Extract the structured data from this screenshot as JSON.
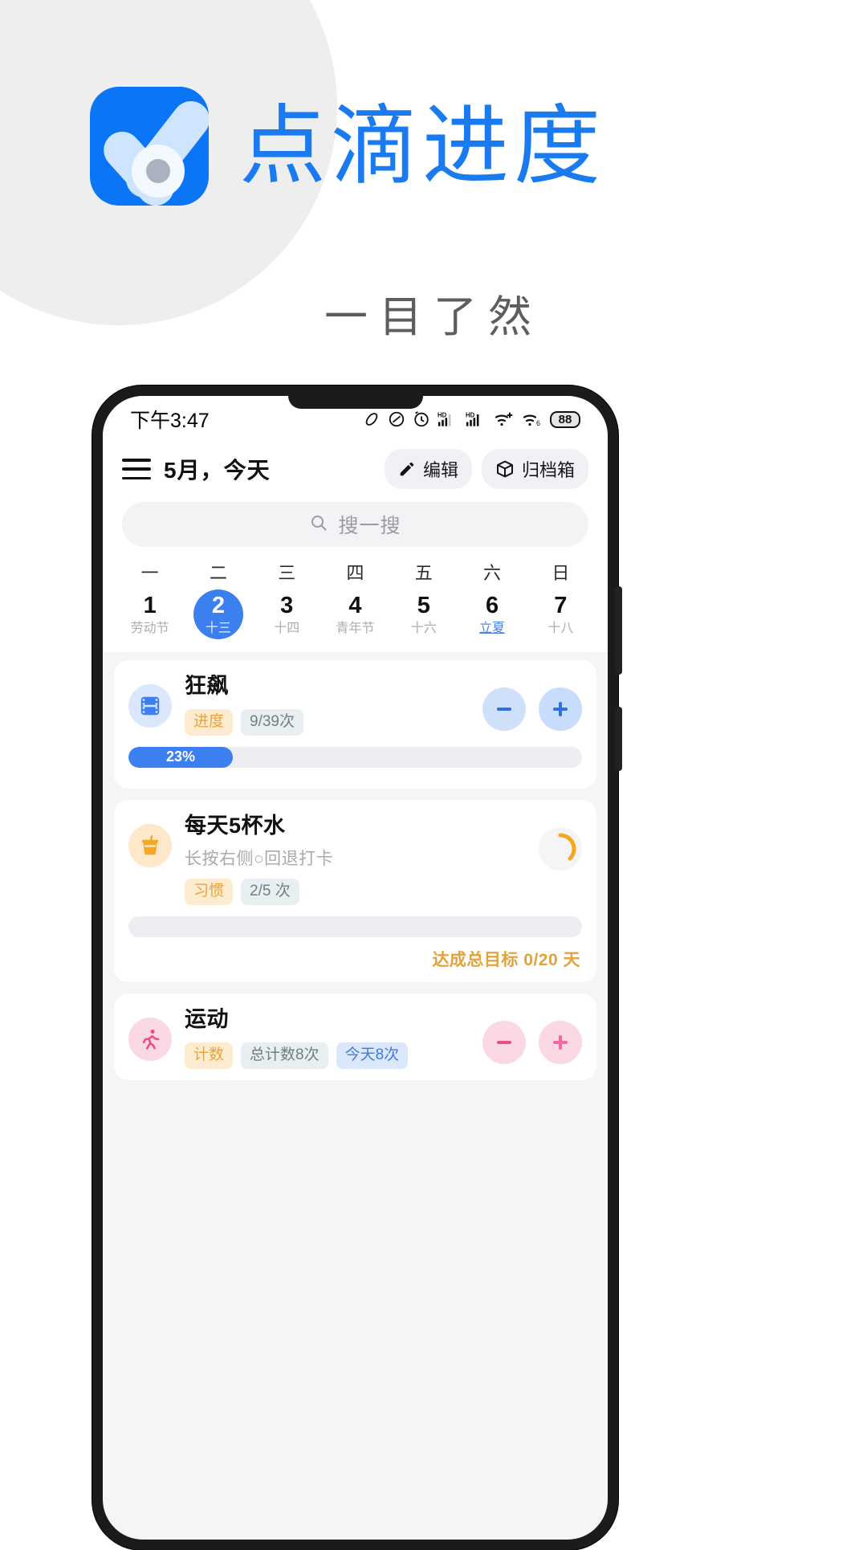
{
  "promo": {
    "app_name": "点滴进度",
    "tagline": "一目了然",
    "icon_name": "app-check-icon",
    "brand_color": "#1a7bf0"
  },
  "statusbar": {
    "time": "下午3:47",
    "battery": "88",
    "icons": [
      "link-icon",
      "mute-icon",
      "alarm-icon",
      "hd-signal-icon",
      "hd-signal-icon",
      "wifi-plus-icon",
      "wifi6-icon",
      "battery-icon"
    ]
  },
  "header": {
    "menu_icon": "hamburger-icon",
    "title": "5月，今天",
    "edit_label": "编辑",
    "edit_icon": "pencil-icon",
    "archive_label": "归档箱",
    "archive_icon": "box-icon"
  },
  "search": {
    "placeholder": "搜一搜",
    "icon": "search-icon"
  },
  "calendar": {
    "days": [
      {
        "dow": "一",
        "num": "1",
        "lunar": "劳动节",
        "selected": false,
        "festival": false
      },
      {
        "dow": "二",
        "num": "2",
        "lunar": "十三",
        "selected": true,
        "festival": false
      },
      {
        "dow": "三",
        "num": "3",
        "lunar": "十四",
        "selected": false,
        "festival": false
      },
      {
        "dow": "四",
        "num": "4",
        "lunar": "青年节",
        "selected": false,
        "festival": false
      },
      {
        "dow": "五",
        "num": "5",
        "lunar": "十六",
        "selected": false,
        "festival": false
      },
      {
        "dow": "六",
        "num": "6",
        "lunar": "立夏",
        "selected": false,
        "festival": true
      },
      {
        "dow": "日",
        "num": "7",
        "lunar": "十八",
        "selected": false,
        "festival": false
      }
    ],
    "selected_color": "#3b7ff0"
  },
  "tasks": [
    {
      "title": "狂飙",
      "subtitle": "",
      "icon": "film-icon",
      "icon_bg": "#dbe7fb",
      "icon_color": "#3b7ff0",
      "tags": [
        {
          "text": "进度",
          "style": "kind"
        },
        {
          "text": "9/39次",
          "style": "count"
        }
      ],
      "progress": {
        "percent": 23,
        "label": "23%",
        "color": "#3b7ff0"
      },
      "controls": {
        "minus": "minus-icon",
        "plus": "plus-icon",
        "style": "blue"
      },
      "goal": ""
    },
    {
      "title": "每天5杯水",
      "subtitle": "长按右侧○回退打卡",
      "icon": "drink-cup-icon",
      "icon_bg": "#fde9c9",
      "icon_color": "#f5a623",
      "tags": [
        {
          "text": "习惯",
          "style": "kind"
        },
        {
          "text": "2/5 次",
          "style": "count"
        }
      ],
      "progress": {
        "percent": 0,
        "label": "",
        "color": "#eceef1"
      },
      "controls": {
        "ring": "ring-progress-icon",
        "style": "orange"
      },
      "goal_prefix": "达成总目标",
      "goal_value": "0/20 天"
    },
    {
      "title": "运动",
      "subtitle": "",
      "icon": "running-icon",
      "icon_bg": "#fbd9e4",
      "icon_color": "#ec4d8a",
      "tags": [
        {
          "text": "计数",
          "style": "kind"
        },
        {
          "text": "总计数8次",
          "style": "count"
        },
        {
          "text": "今天8次",
          "style": "today"
        }
      ],
      "controls": {
        "minus": "minus-icon",
        "plus": "plus-icon",
        "style": "pink"
      },
      "goal": ""
    }
  ]
}
